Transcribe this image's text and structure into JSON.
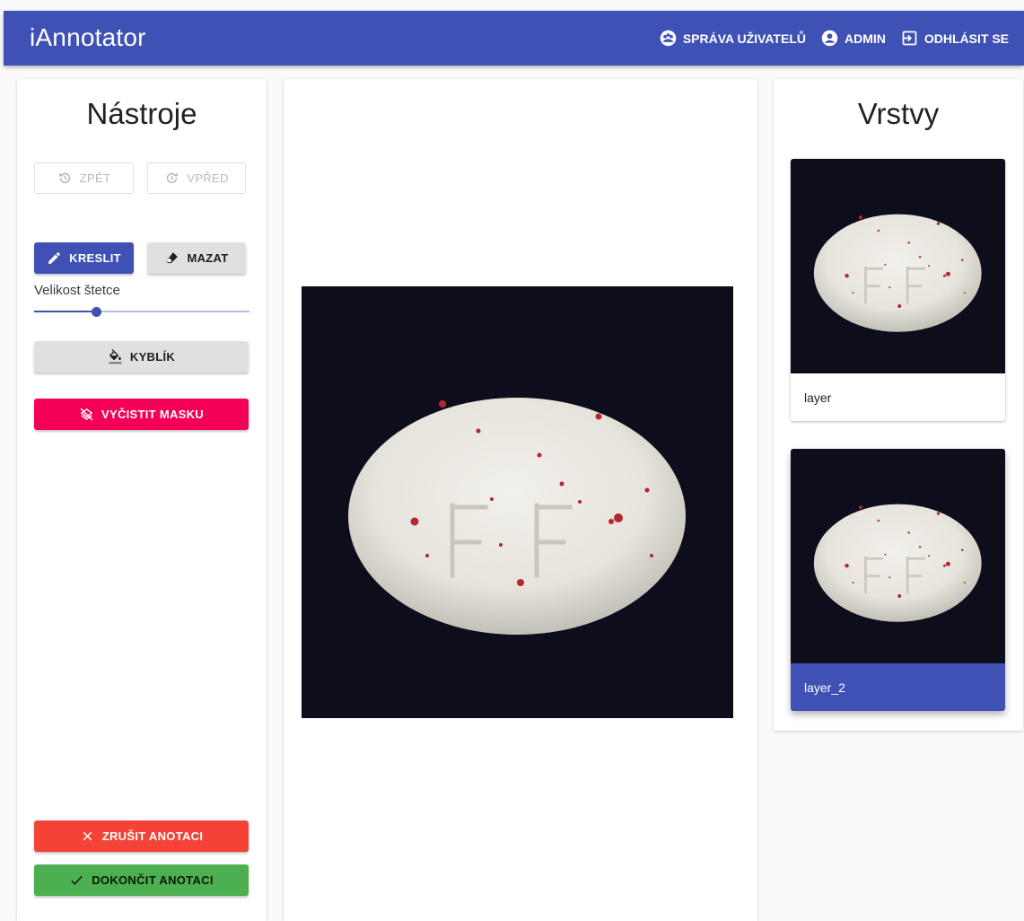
{
  "app": {
    "title": "iAnnotator",
    "nav": [
      {
        "label": "SPRÁVA UŽIVATELŮ",
        "icon": "users-group-icon"
      },
      {
        "label": "ADMIN",
        "icon": "account-circle-icon"
      },
      {
        "label": "ODHLÁSIT SE",
        "icon": "logout-icon"
      }
    ]
  },
  "tools": {
    "title": "Nástroje",
    "undo_label": "ZPĚT",
    "redo_label": "VPŘED",
    "draw_label": "KRESLIT",
    "erase_label": "MAZAT",
    "brush_size_label": "Velikost štetce",
    "brush_size_fraction": 0.29,
    "bucket_label": "KYBLÍK",
    "clear_mask_label": "VYČISTIT MASKU",
    "cancel_label": "ZRUŠIT ANOTACI",
    "finish_label": "DOKONČIT ANOTACI"
  },
  "layers": {
    "title": "Vrstvy",
    "items": [
      {
        "name": "layer",
        "selected": false
      },
      {
        "name": "layer_2",
        "selected": true
      }
    ]
  },
  "colors": {
    "primary": "#3f51b5",
    "secondary": "#f50057",
    "error": "#f44336",
    "success": "#4caf50",
    "grey_button": "#e0e0e0"
  }
}
